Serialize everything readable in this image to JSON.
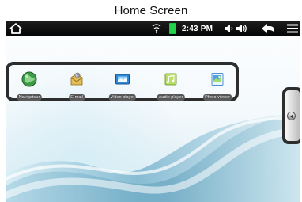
{
  "page": {
    "title": "Home Screen"
  },
  "status_bar": {
    "time": "2:43 PM",
    "icons": {
      "home": "home-icon",
      "wifi": "wifi-icon",
      "battery": "battery-icon",
      "volume_down": "volume-down-icon",
      "volume_up": "volume-up-icon",
      "back": "back-icon",
      "menu": "menu-icon"
    },
    "colors": {
      "bar": "#050505",
      "battery": "#25d24b",
      "foreground": "#ffffff"
    }
  },
  "desktop": {
    "apps": [
      {
        "label": "Navigateur",
        "icon": "globe-icon",
        "accent": "#2f9a3c"
      },
      {
        "label": "E-mail",
        "icon": "email-icon",
        "accent": "#e1b44c"
      },
      {
        "label": "Video player",
        "icon": "video-player-icon",
        "accent": "#2c86d4"
      },
      {
        "label": "Audio player",
        "icon": "audio-player-icon",
        "accent": "#8cc53f"
      },
      {
        "label": "Photo viewer",
        "icon": "photo-viewer-icon",
        "accent": "#3c8dd7"
      }
    ],
    "side_handle_icon": "left-arrow-icon",
    "colors": {
      "outline": "#2d2d2d",
      "label_bg": "#5b5b5b",
      "wallpaper_blue": "#8ebfd6"
    }
  }
}
